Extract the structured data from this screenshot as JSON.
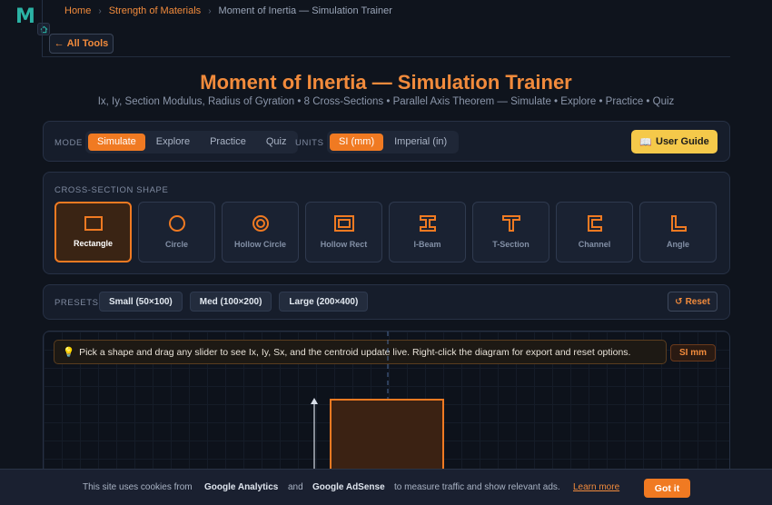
{
  "brand": {
    "logo_letter": "M"
  },
  "breadcrumb": {
    "home": "Home",
    "category": "Strength of Materials",
    "current": "Moment of Inertia — Simulation Trainer"
  },
  "nav": {
    "all_tools": "All Tools",
    "back_arrow": "←"
  },
  "header": {
    "title": "Moment of Inertia — Simulation Trainer",
    "subtitle": "Ix, Iy, Section Modulus, Radius of Gyration • 8 Cross-Sections • Parallel Axis Theorem — Simulate • Explore • Practice • Quiz"
  },
  "controls": {
    "mode_label": "MODE",
    "modes": [
      "Simulate",
      "Explore",
      "Practice",
      "Quiz"
    ],
    "active_mode": "Simulate",
    "units_label": "UNITS",
    "units": [
      "SI (mm)",
      "Imperial (in)"
    ],
    "active_unit": "SI (mm)",
    "user_guide": "User Guide",
    "user_guide_icon": "📖"
  },
  "shapes": {
    "label": "CROSS-SECTION SHAPE",
    "items": [
      "Rectangle",
      "Circle",
      "Hollow Circle",
      "Hollow Rect",
      "I-Beam",
      "T-Section",
      "Channel",
      "Angle"
    ],
    "active": "Rectangle"
  },
  "presets": {
    "label": "PRESETS",
    "items": [
      "Small (50×100)",
      "Med (100×200)",
      "Large (200×400)"
    ],
    "reset": "Reset",
    "reset_icon": "↺"
  },
  "sim": {
    "hint_icon": "💡",
    "hint": "Pick a shape and drag any slider to see Ix, Iy, Sx, and the centroid update live. Right-click the diagram for export and reset options.",
    "unit_badge": "SI mm"
  },
  "cookie": {
    "text1": "This site uses cookies from",
    "ga": "Google Analytics",
    "and": "and",
    "ads": "Google AdSense",
    "text2": "to measure traffic and show relevant ads.",
    "learn_more": "Learn more",
    "got_it": "Got it"
  },
  "colors": {
    "accent": "#f07a22",
    "accent_text": "#f28b3c",
    "guide": "#f5c94a",
    "bg": "#0f141d"
  }
}
